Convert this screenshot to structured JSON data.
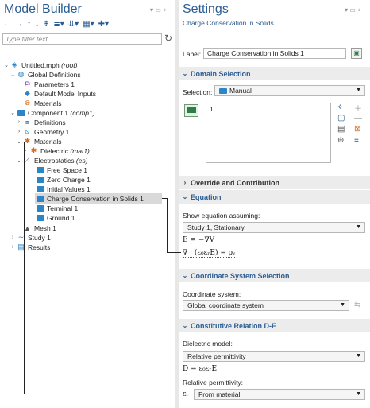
{
  "left_panel": {
    "title": "Model Builder",
    "filter_placeholder": "Type filter text",
    "tree": [
      {
        "label": "Untitled.mph",
        "suffix": "(root)"
      },
      {
        "label": "Global Definitions",
        "suffix": ""
      },
      {
        "label": "Parameters 1",
        "suffix": ""
      },
      {
        "label": "Default Model Inputs",
        "suffix": ""
      },
      {
        "label": "Materials",
        "suffix": ""
      },
      {
        "label": "Component 1",
        "suffix": "(comp1)"
      },
      {
        "label": "Definitions",
        "suffix": ""
      },
      {
        "label": "Geometry 1",
        "suffix": ""
      },
      {
        "label": "Materials",
        "suffix": ""
      },
      {
        "label": "Dielectric",
        "suffix": "(mat1)"
      },
      {
        "label": "Electrostatics",
        "suffix": "(es)"
      },
      {
        "label": "Free Space 1",
        "suffix": ""
      },
      {
        "label": "Zero Charge 1",
        "suffix": ""
      },
      {
        "label": "Initial Values 1",
        "suffix": ""
      },
      {
        "label": "Charge Conservation in Solids 1",
        "suffix": ""
      },
      {
        "label": "Terminal 1",
        "suffix": ""
      },
      {
        "label": "Ground 1",
        "suffix": ""
      },
      {
        "label": "Mesh 1",
        "suffix": ""
      },
      {
        "label": "Study 1",
        "suffix": ""
      },
      {
        "label": "Results",
        "suffix": ""
      }
    ]
  },
  "right_panel": {
    "title": "Settings",
    "subtitle": "Charge Conservation in Solids",
    "label_caption": "Label:",
    "label_value": "Charge Conservation in Solids 1",
    "domain_section": "Domain Selection",
    "selection_caption": "Selection:",
    "selection_value": "Manual",
    "selection_list_item": "1",
    "override_section": "Override and Contribution",
    "equation_section": "Equation",
    "show_equation_caption": "Show equation assuming:",
    "show_equation_value": "Study 1, Stationary",
    "eq1": "E = −∇V",
    "eq2": "∇ · (ε₀εᵣE) = ρᵥ",
    "coord_section": "Coordinate System Selection",
    "coord_caption": "Coordinate system:",
    "coord_value": "Global coordinate system",
    "constitutive_section": "Constitutive Relation D-E",
    "dielectric_caption": "Dielectric model:",
    "dielectric_value": "Relative permittivity",
    "eq3": "D = ε₀εᵣE",
    "rel_perm_caption": "Relative permittivity:",
    "rel_perm_symbol": "εᵣ",
    "rel_perm_value": "From material"
  }
}
